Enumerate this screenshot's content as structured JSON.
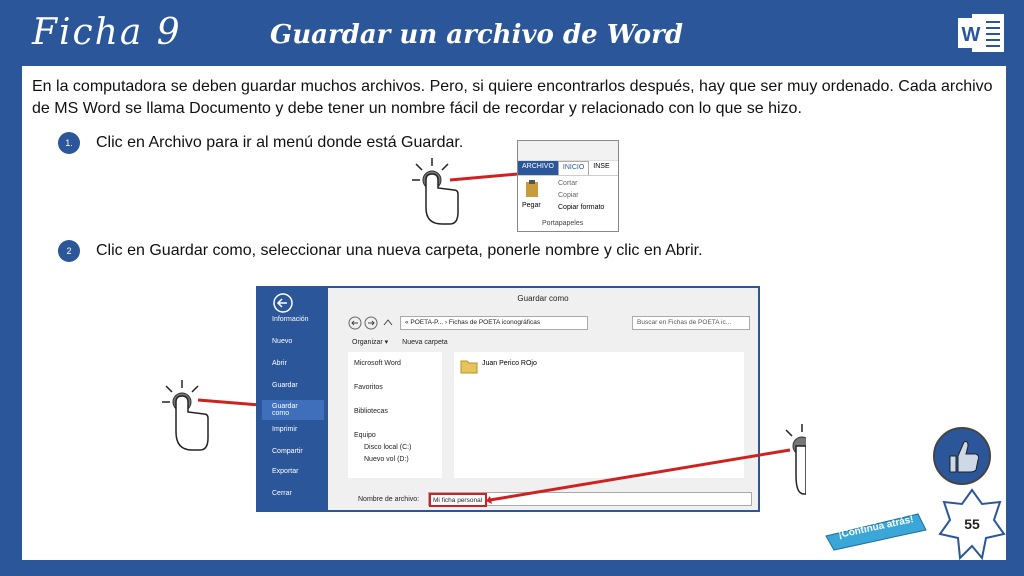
{
  "header": {
    "ficha": "Ficha 9",
    "title": "Guardar un archivo de Word",
    "logo_icon": "word-logo-icon"
  },
  "intro": "En la computadora se deben guardar muchos archivos. Pero, si quiere encontrarlos después, hay que ser muy ordenado. Cada archivo de MS Word se llama Documento y debe tener un nombre fácil de recordar y relacionado con lo que se hizo.",
  "steps": [
    {
      "num": "1.",
      "text": "Clic en Archivo para ir al menú donde está Guardar."
    },
    {
      "num": "2",
      "text": "Clic en Guardar como, seleccionar una nueva carpeta, ponerle nombre y clic en Abrir."
    }
  ],
  "ribbon": {
    "tabs": [
      "ARCHIVO",
      "INICIO",
      "INSE"
    ],
    "paste": "Pegar",
    "cut": "Cortar",
    "copy": "Copiar",
    "format": "Copiar formato",
    "group": "Portapapeles"
  },
  "dialog": {
    "title": "Guardar como",
    "side_items": [
      "Información",
      "Nuevo",
      "Abrir",
      "Guardar",
      "Guardar como",
      "Imprimir",
      "Compartir",
      "Exportar",
      "Cerrar"
    ],
    "address": "« POETA-P... › Fichas de POETA iconográficas",
    "search_placeholder": "Buscar en Fichas de POETA ic...",
    "organize": "Organizar ▾",
    "new_folder": "Nueva carpeta",
    "nav_items": [
      "Microsoft Word",
      "Favoritos",
      "Bibliotecas",
      "Equipo",
      "Disco local (C:)",
      "Nuevo vol (D:)"
    ],
    "folder": "Juan Perico ROjo",
    "filename_label": "Nombre de archivo:",
    "filename_value": "Mi ficha personal"
  },
  "footer": {
    "continue": "¡Continúa atrás!",
    "page": "55"
  },
  "colors": {
    "brand": "#2b579a",
    "arrow": "#d02020"
  }
}
